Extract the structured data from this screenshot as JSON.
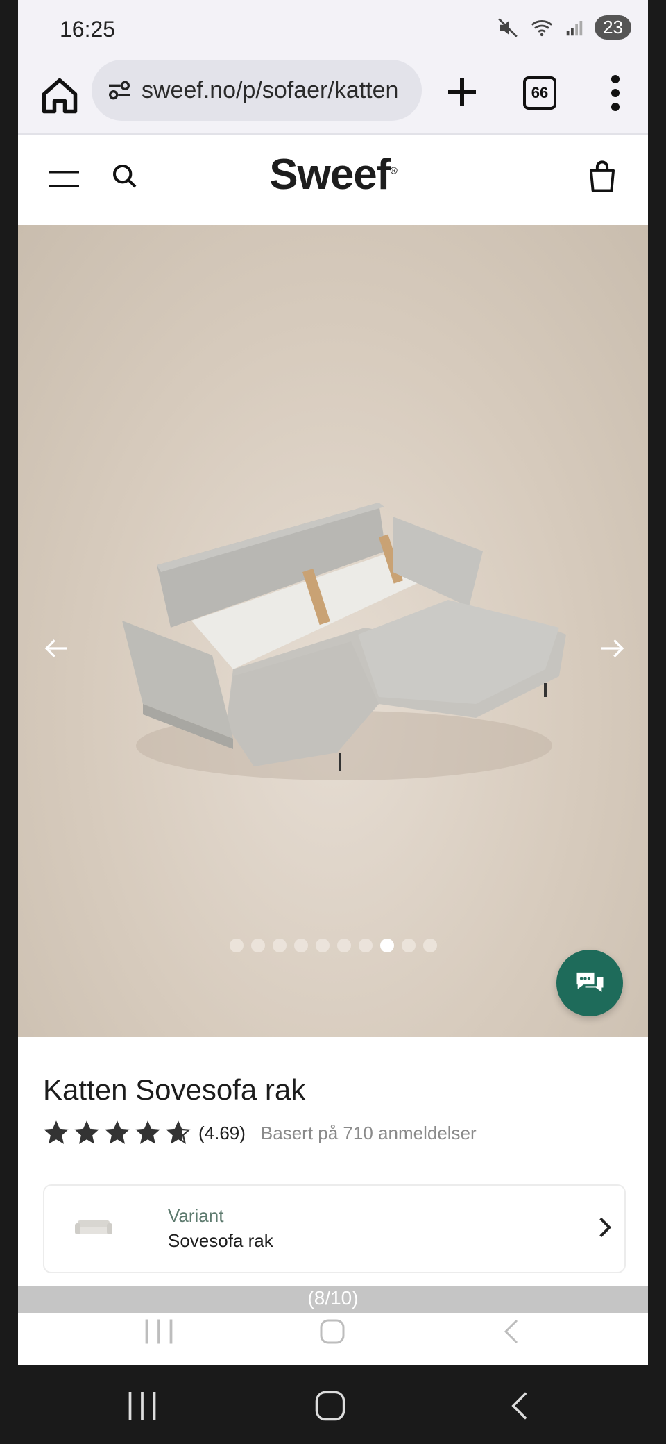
{
  "status_bar": {
    "time": "16:25",
    "battery": "23",
    "icons": [
      "mute-icon",
      "wifi-icon",
      "signal-icon"
    ]
  },
  "browser": {
    "url": "sweef.no/p/sofaer/katten",
    "tab_count": "66",
    "icons": [
      "home-icon",
      "site-settings-icon",
      "plus-icon",
      "tabs-icon",
      "more-vert-icon"
    ]
  },
  "site_header": {
    "logo": "Sweef",
    "logo_mark": "®",
    "icons": [
      "menu-icon",
      "search-icon",
      "bag-icon"
    ]
  },
  "gallery": {
    "dots_total": 10,
    "active_index": 8,
    "counter": "(8/10)",
    "icons": [
      "arrow-left-icon",
      "arrow-right-icon"
    ]
  },
  "chat": {
    "icon": "chat-icon",
    "color": "#1e6b5a"
  },
  "product": {
    "title": "Katten Sovesofa rak",
    "rating_score": "(4.69)",
    "stars": 4.69,
    "reviews": "Basert på 710 anmeldelser"
  },
  "variant": {
    "label": "Variant",
    "value": "Sovesofa rak"
  },
  "colors": {
    "accent": "#1e6b5a",
    "variant_label": "#5d7a6e",
    "hero_bg": "#d7cbbd"
  }
}
